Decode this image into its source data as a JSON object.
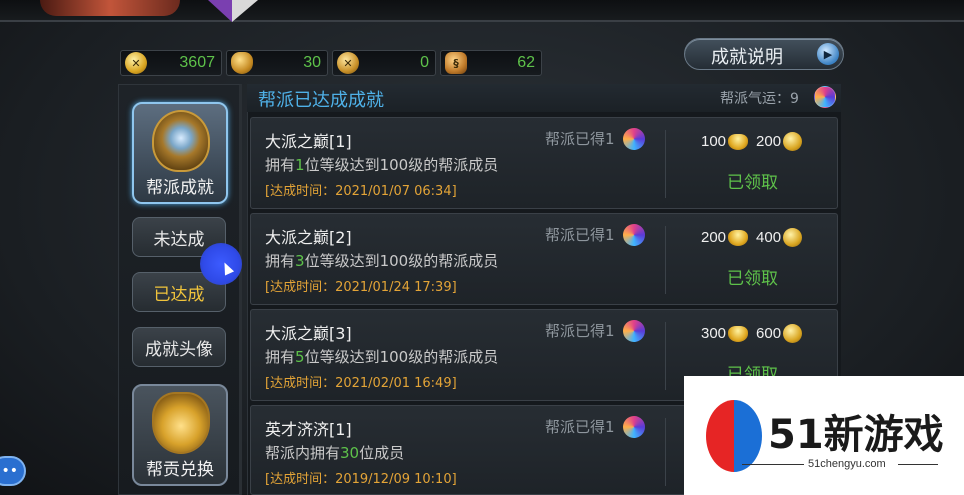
{
  "resources": [
    {
      "icon": "gold-coin-icon",
      "value": "3607"
    },
    {
      "icon": "helmet-icon",
      "value": "30"
    },
    {
      "icon": "crossed-swords-icon",
      "value": "0"
    },
    {
      "icon": "shield-emblem-icon",
      "value": "62"
    }
  ],
  "explain_button": {
    "label": "成就说明"
  },
  "side_tabs": {
    "guild_achievement": "帮派成就",
    "incomplete": "未达成",
    "completed": "已达成",
    "avatar": "成就头像",
    "exchange": "帮贡兑换"
  },
  "main": {
    "title": "帮派已达成成就",
    "luck_label": "帮派气运：9"
  },
  "achievements": [
    {
      "name": "大派之巅[1]",
      "desc_pre": "拥有",
      "desc_num": "1",
      "desc_post": "位等级达到100级的帮派成员",
      "time": "[达成时间：2021/01/07  06:34]",
      "got": "帮派已得1",
      "reward_ingot": "100",
      "reward_coin": "200",
      "status": "已领取"
    },
    {
      "name": "大派之巅[2]",
      "desc_pre": "拥有",
      "desc_num": "3",
      "desc_post": "位等级达到100级的帮派成员",
      "time": "[达成时间：2021/01/24  17:39]",
      "got": "帮派已得1",
      "reward_ingot": "200",
      "reward_coin": "400",
      "status": "已领取"
    },
    {
      "name": "大派之巅[3]",
      "desc_pre": "拥有",
      "desc_num": "5",
      "desc_post": "位等级达到100级的帮派成员",
      "time": "[达成时间：2021/02/01  16:49]",
      "got": "帮派已得1",
      "reward_ingot": "300",
      "reward_coin": "600",
      "status": "已领取"
    },
    {
      "name": "英才济济[1]",
      "desc_pre": "帮派内拥有",
      "desc_num": "30",
      "desc_post": "位成员",
      "time": "[达成时间：2019/12/09  10:10]",
      "got": "帮派已得1",
      "reward_ingot": "",
      "reward_coin": "",
      "status": ""
    }
  ],
  "watermark": {
    "text": "51新游戏",
    "sub": "51chengyu.com"
  },
  "chat": {
    "label": "•••"
  }
}
